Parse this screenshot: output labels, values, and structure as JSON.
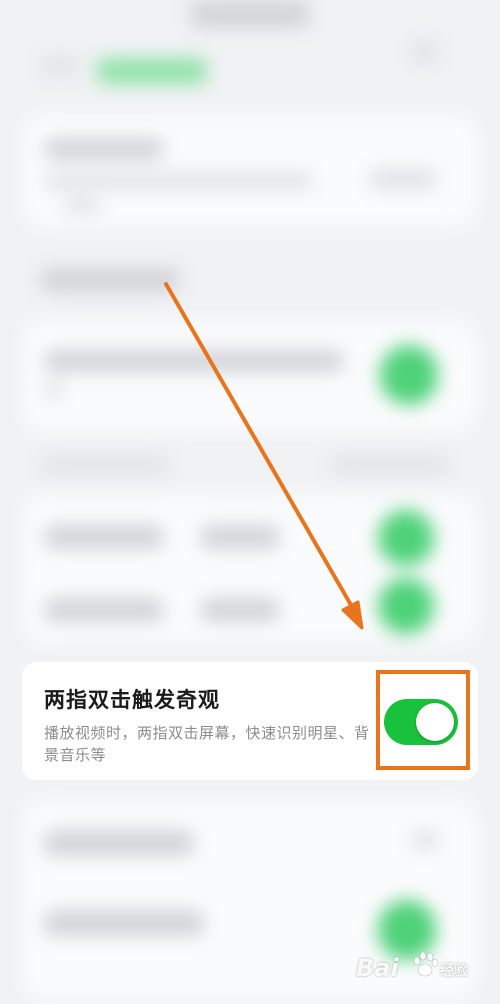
{
  "setting_card": {
    "title": "两指双击触发奇观",
    "description": "播放视频时，两指双击屏幕，快速识别明星、背景音乐等",
    "toggle_state": "on"
  },
  "watermark": {
    "brand_left": "Bai",
    "brand_right": "经验"
  },
  "colors": {
    "toggle_on": "#19c23c",
    "highlight": "#e8741e",
    "card_background": "#ffffff",
    "page_background": "#f1f2f4"
  },
  "icons": {
    "annotation_arrow": "arrow-down-right-icon",
    "watermark_logo": "paw-icon"
  }
}
